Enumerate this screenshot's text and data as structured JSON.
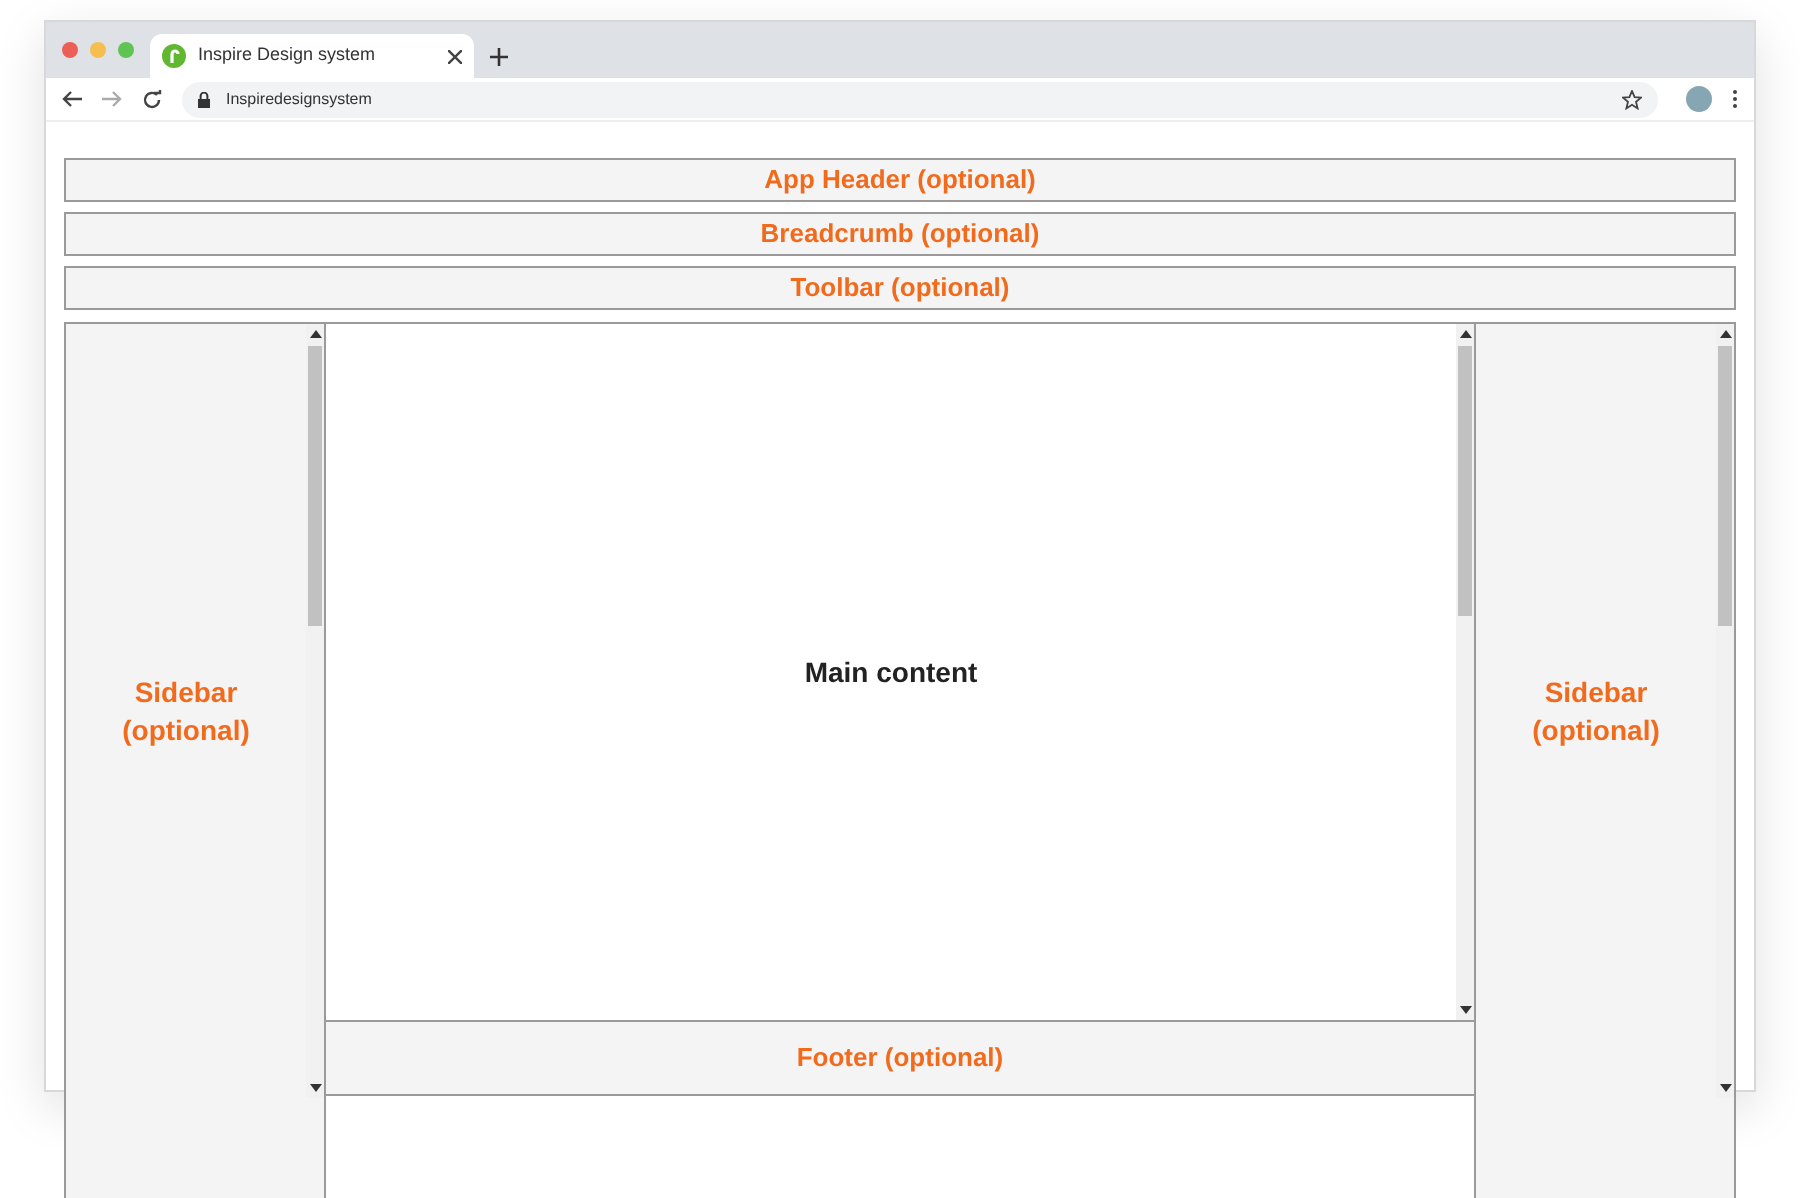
{
  "browser": {
    "tab": {
      "title": "Inspire Design system",
      "selected": true
    },
    "url": "Inspiredesignsystem"
  },
  "layout": {
    "bars": [
      "App Header (optional)",
      "Breadcrumb (optional)",
      "Toolbar (optional)"
    ],
    "left_sidebar": "Sidebar (optional)",
    "main": "Main content",
    "footer": "Footer (optional)",
    "right_sidebar": "Sidebar (optional)"
  }
}
